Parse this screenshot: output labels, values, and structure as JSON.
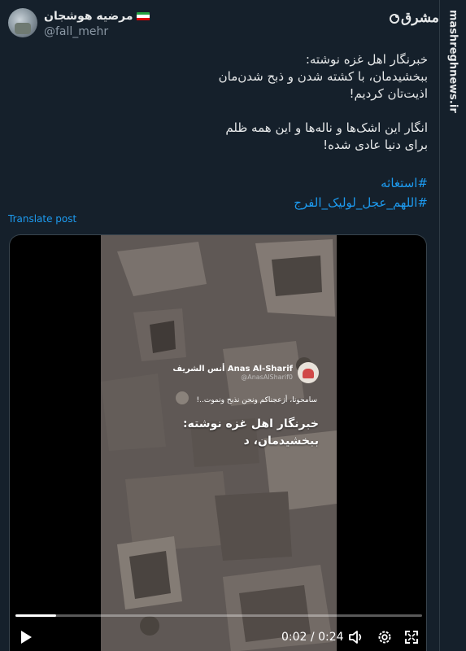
{
  "author": {
    "display_name": "مرضیه هوشجان",
    "handle": "@fall_mehr",
    "flag_icon": "iran-flag-icon"
  },
  "brand": {
    "logo_text": "مشرق",
    "logo_icon": "mashregh-logo-icon",
    "watermark": "mashreghnews.ir"
  },
  "post": {
    "lines": [
      "خبرنگار اهل غزه نوشته:",
      "ببخشیدمان، با کشته شدن و ذبح شدن‌مان",
      "اذیت‌تان کردیم!",
      "انگار این اشک‌ها و ناله‌ها و این همه ظلم",
      "برای دنیا عادی شده!"
    ],
    "hashtags": [
      "#استغاثه",
      "#اللهم_عجل_لولیک_الفرج"
    ],
    "translate_label": "Translate post"
  },
  "video": {
    "overlay": {
      "channel_name": "أنس الشريف Anas Al-Sharif",
      "channel_handle": "@AnasAlSharif0",
      "caption_small": "سامحونا، أزعجناكم ونحن نذبح ونموت..!",
      "caption_line1": "خبرنگار اهل غزه نوشته:",
      "caption_line2": "ببخشیدمان، د"
    },
    "current_time": "0:02",
    "separator": " / ",
    "duration": "0:24",
    "progress": 0.1,
    "icons": {
      "play": "play-icon",
      "volume": "volume-icon",
      "settings": "gear-icon",
      "fullscreen": "fullscreen-icon"
    }
  },
  "colors": {
    "background": "#15202b",
    "link": "#1d9bf0",
    "secondary_text": "#8b98a5"
  }
}
